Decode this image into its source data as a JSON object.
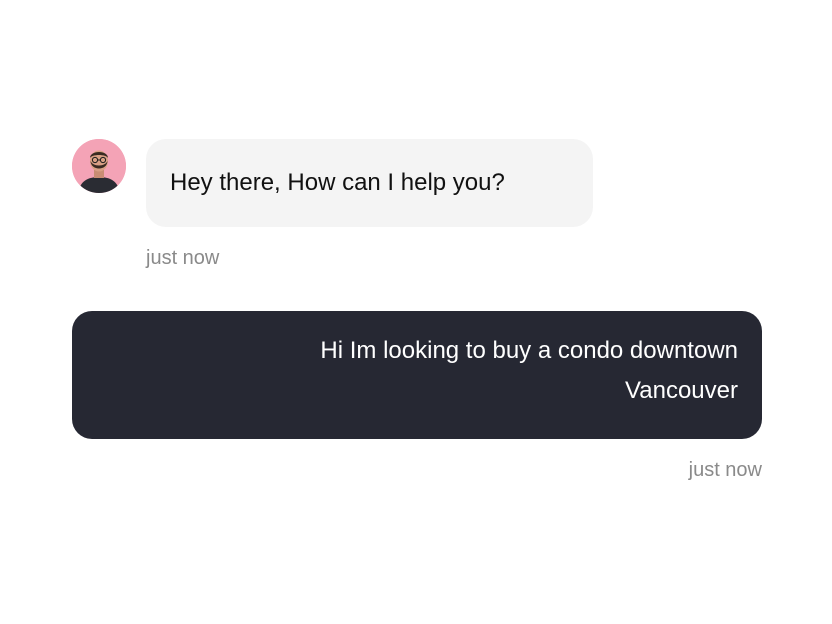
{
  "incoming": {
    "message": "Hey there, How can I help you?",
    "timestamp": "just now",
    "avatar_icon": "agent-avatar-photo"
  },
  "outgoing": {
    "message_lines": [
      "Hi Im looking to buy a condo downtown",
      "Vancouver"
    ],
    "timestamp": "just now"
  },
  "colors": {
    "incoming_bubble": "#f4f4f4",
    "outgoing_bubble": "#262833",
    "timestamp": "#8a8a8a",
    "avatar_bg": "#f4a3b6"
  }
}
